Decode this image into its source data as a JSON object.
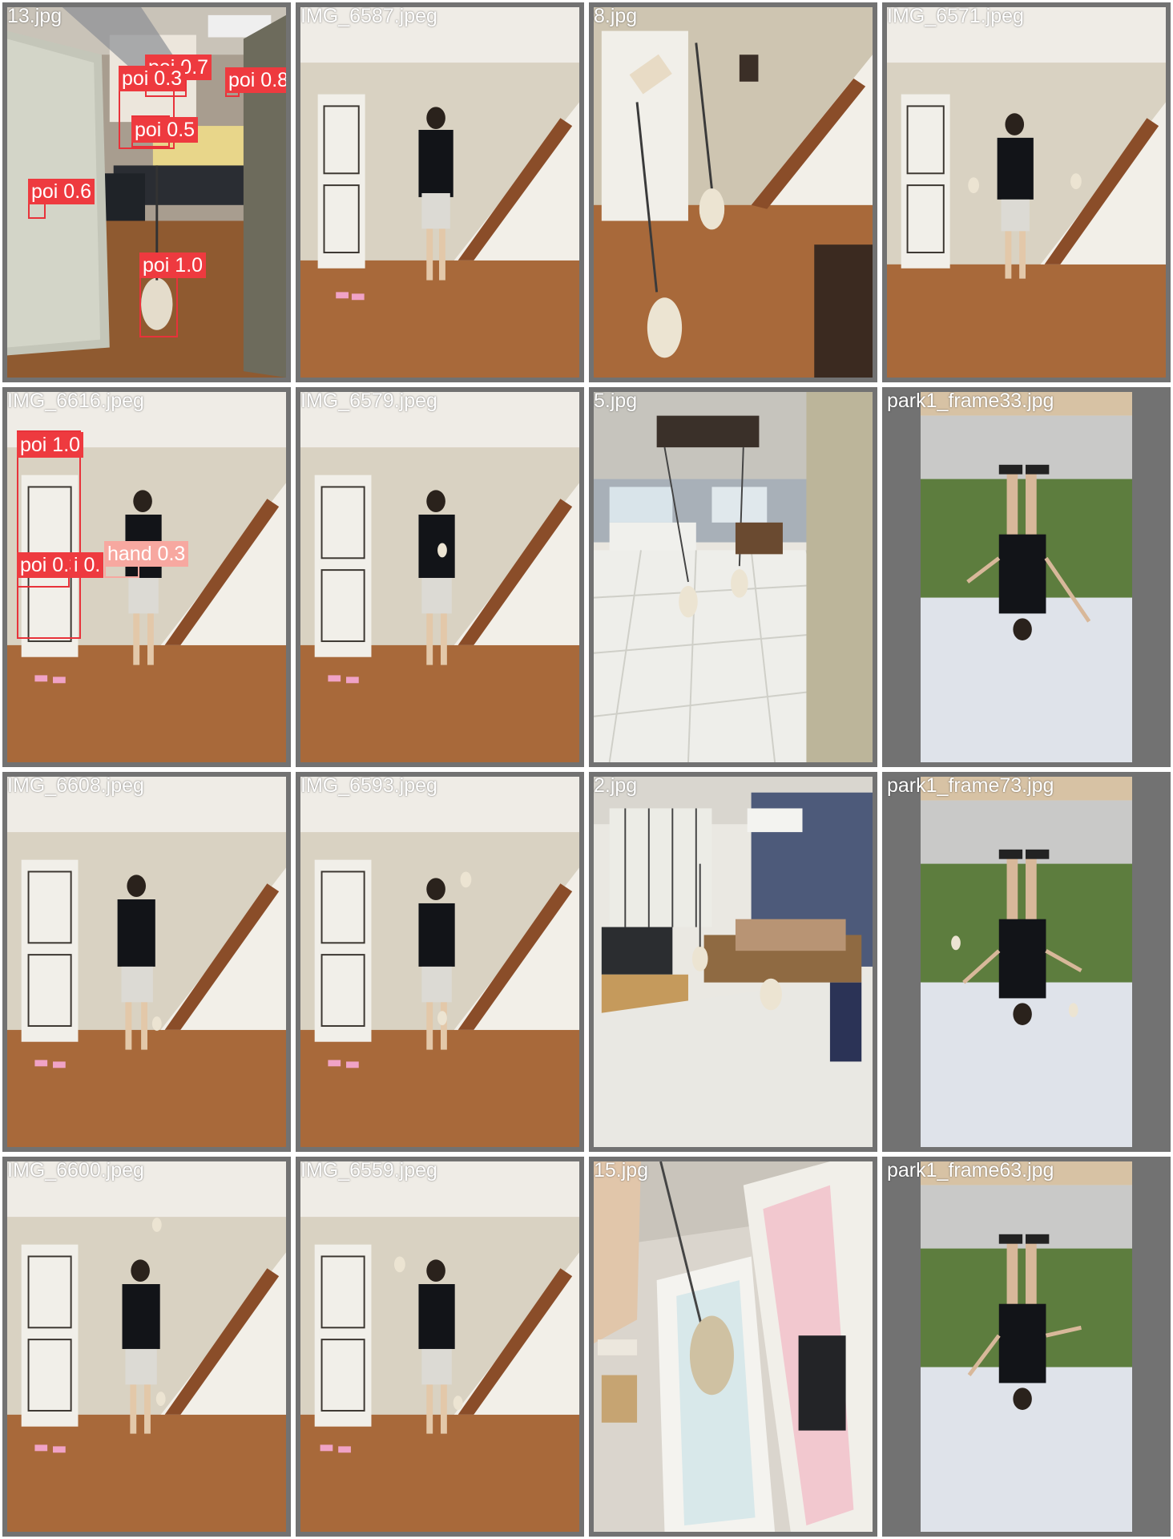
{
  "images": [
    {
      "file": "13.jpg",
      "scene": "bedroom",
      "detections": [
        {
          "label": "poi 0.3"
        },
        {
          "label": "poi 0.7"
        },
        {
          "label": "poi 0.8"
        },
        {
          "label": "poi 0.5"
        },
        {
          "label": "poi 0.6"
        },
        {
          "label": "poi 1.0"
        }
      ]
    },
    {
      "file": "IMG_6587.jpeg",
      "scene": "hallway"
    },
    {
      "file": "8.jpg",
      "scene": "staircase-closeup"
    },
    {
      "file": "IMG_6571.jpeg",
      "scene": "hallway"
    },
    {
      "file": "IMG_6616.jpeg",
      "scene": "hallway",
      "detections": [
        {
          "label": "poi 1.0"
        },
        {
          "label": "poi 0.3"
        },
        {
          "label": "i 0."
        },
        {
          "label": "hand 0.3"
        }
      ]
    },
    {
      "file": "IMG_6579.jpeg",
      "scene": "hallway"
    },
    {
      "file": "5.jpg",
      "scene": "kitchen"
    },
    {
      "file": "park1_frame33.jpg",
      "scene": "park-upside-down"
    },
    {
      "file": "IMG_6608.jpeg",
      "scene": "hallway"
    },
    {
      "file": "IMG_6593.jpeg",
      "scene": "hallway"
    },
    {
      "file": "2.jpg",
      "scene": "dining-room"
    },
    {
      "file": "park1_frame73.jpg",
      "scene": "park-upside-down"
    },
    {
      "file": "IMG_6600.jpeg",
      "scene": "hallway"
    },
    {
      "file": "IMG_6559.jpeg",
      "scene": "hallway"
    },
    {
      "file": "15.jpg",
      "scene": "doorway"
    },
    {
      "file": "park1_frame63.jpg",
      "scene": "park-upside-down"
    }
  ],
  "colors": {
    "background": "#727272",
    "gutter": "#ffffff",
    "box": "#e8323a",
    "hand_box": "#f7a8a0",
    "label_text": "#ffffff"
  }
}
